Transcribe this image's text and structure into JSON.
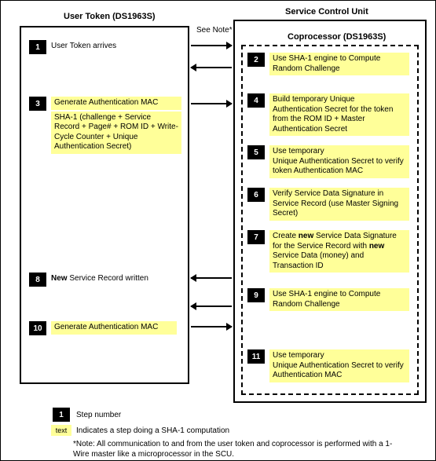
{
  "titles": {
    "left": "User Token (DS1963S)",
    "right": "Service Control Unit",
    "coproc": "Coprocessor (DS1963S)",
    "see_note": "See Note*"
  },
  "left_steps": {
    "s1": {
      "n": "1",
      "text": "User Token arrives",
      "sha": false
    },
    "s3": {
      "n": "3",
      "text": "Generate Authentication MAC",
      "sha": true,
      "sub": "SHA-1 (challenge + Service Record + Page# + ROM ID + Write-Cycle Counter + Unique Authentication Secret)"
    },
    "s8": {
      "n": "8",
      "prefix": "New ",
      "text": "Service Record written",
      "sha": false
    },
    "s10": {
      "n": "10",
      "text": "Generate Authentication MAC",
      "sha": true
    }
  },
  "right_steps": {
    "s2": {
      "n": "2",
      "text": "Use SHA-1 engine to Compute Random Challenge",
      "sha": true
    },
    "s4": {
      "n": "4",
      "text": "Build temporary Unique Authentication Secret for the token from the ROM ID  + Master Authentication Secret",
      "sha": true
    },
    "s5": {
      "n": "5",
      "text": "Use temporary\nUnique Authentication Secret to verify token Authentication MAC",
      "sha": true
    },
    "s6": {
      "n": "6",
      "text": "Verify Service Data Signature in Service Record (use Master Signing Secret)",
      "sha": true
    },
    "s7": {
      "n": "7",
      "pre": "Create ",
      "bold1": "new",
      "mid": " Service Data Signature for the Service Record with ",
      "bold2": "new",
      "post": " Service Data (money) and Transaction ID",
      "sha": true
    },
    "s9": {
      "n": "9",
      "text": "Use SHA-1 engine to Compute Random Challenge",
      "sha": true
    },
    "s11": {
      "n": "11",
      "text": "Use temporary\nUnique Authentication Secret to verify Authentication MAC",
      "sha": true
    }
  },
  "legend": {
    "num": "1",
    "num_label": "Step number",
    "swatch": "text",
    "swatch_label": "Indicates a step doing a SHA-1 computation"
  },
  "footnote": "*Note: All communication to and from the user token and coprocessor is performed with a 1-Wire master like a microprocessor in the SCU."
}
